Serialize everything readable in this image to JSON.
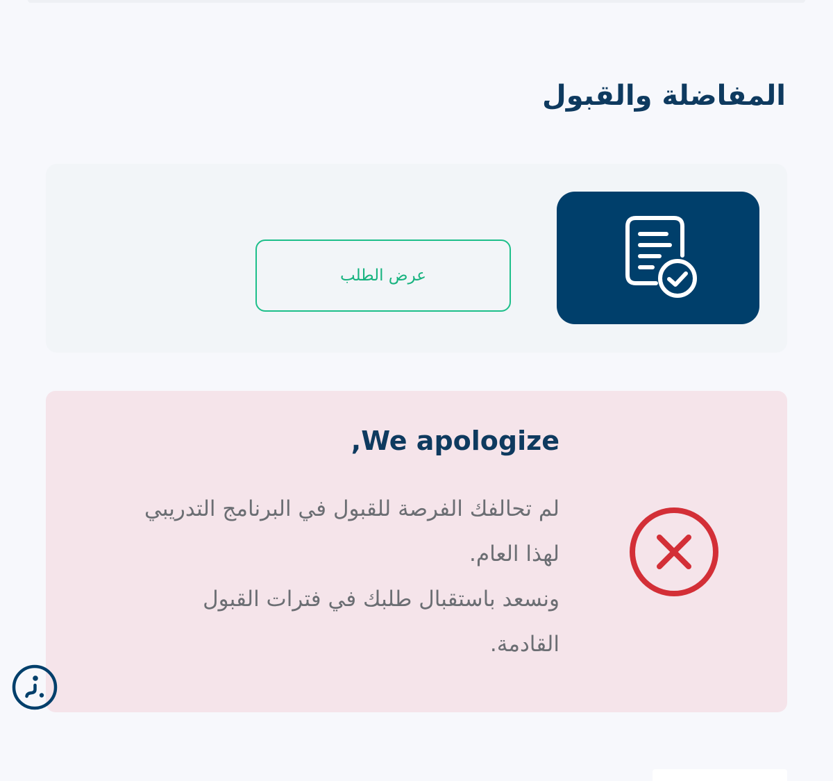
{
  "page": {
    "title": "المفاضلة والقبول"
  },
  "request_card": {
    "icon": "document-check-icon",
    "view_button_label": "عرض الطلب"
  },
  "notice": {
    "icon": "error-x-circle-icon",
    "heading": "We apologize,",
    "lines": [
      "لم تحالفك الفرصة للقبول في البرنامج التدريبي",
      "لهذا العام.",
      "ونسعد باستقبال طلبك في فترات القبول",
      "القادمة."
    ]
  },
  "accessibility": {
    "icon": "accessibility-icon"
  },
  "colors": {
    "primary": "#003f6b",
    "title": "#0e3a5f",
    "accent_green": "#1dbf8a",
    "error_red": "#d32f37",
    "notice_bg": "#f5e4ea",
    "card_bg": "#f2f5f8",
    "page_bg": "#f7f8fc",
    "body_text": "#6b6e73"
  }
}
